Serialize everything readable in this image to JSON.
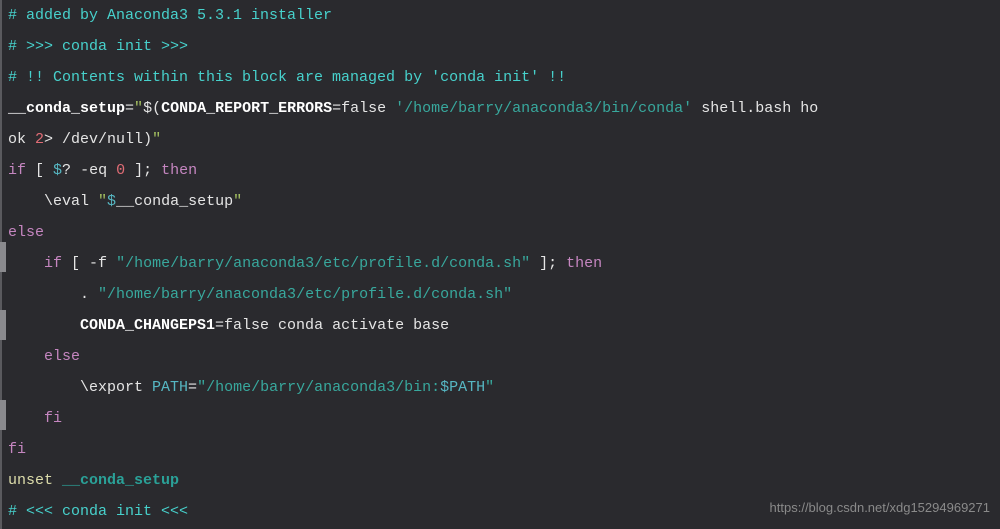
{
  "code": {
    "line1_comment": "# added by Anaconda3 5.3.1 installer",
    "line2_comment": "# >>> conda init >>>",
    "line3_comment": "# !! Contents within this block are managed by 'conda init' !!",
    "l4_var": "__conda_setup",
    "l4_eq": "=",
    "l4_q1": "\"",
    "l4_dollar_open": "$(",
    "l4_env": "CONDA_REPORT_ERRORS",
    "l4_eqfalse": "=false ",
    "l4_path": "'/home/barry/anaconda3/bin/conda'",
    "l4_tail": " shell.bash ho",
    "l5_pre": "ok ",
    "l5_num": "2",
    "l5_redir": "> ",
    "l5_devnull": "/dev/null",
    "l5_close": ")",
    "l5_q2": "\"",
    "l6_if": "if",
    "l6_bracket_o": " [ ",
    "l6_dollar": "$",
    "l6_q": "?",
    "l6_eq": " -eq ",
    "l6_zero": "0",
    "l6_bracket_c": " ]; ",
    "l6_then": "then",
    "l7_indent": "    ",
    "l7_eval": "\\eval ",
    "l7_q1": "\"",
    "l7_dollar": "$",
    "l7_var": "__conda_setup",
    "l7_q2": "\"",
    "l8_else": "else",
    "l9_indent": "    ",
    "l9_if": "if",
    "l9_bo": " [ ",
    "l9_f": "-f ",
    "l9_path": "\"/home/barry/anaconda3/etc/profile.d/conda.sh\"",
    "l9_bc": " ]; ",
    "l9_then": "then",
    "l10_indent": "        ",
    "l10_dot": ". ",
    "l10_path": "\"/home/barry/anaconda3/etc/profile.d/conda.sh\"",
    "l11_indent": "        ",
    "l11_var": "CONDA_CHANGEPS1",
    "l11_rest": "=false conda activate base",
    "l12_indent": "    ",
    "l12_else": "else",
    "l13_indent": "        ",
    "l13_export": "\\export ",
    "l13_path_var": "PATH",
    "l13_eq": "=",
    "l13_q1": "\"",
    "l13_str": "/home/barry/anaconda3/bin:",
    "l13_dollar": "$PATH",
    "l13_q2": "\"",
    "l14_indent": "    ",
    "l14_fi": "fi",
    "l15_fi": "fi",
    "l16_unset": "unset ",
    "l16_var": "__conda_setup",
    "l17_comment": "# <<< conda init <<<"
  },
  "watermark": "https://blog.csdn.net/xdg15294969271"
}
